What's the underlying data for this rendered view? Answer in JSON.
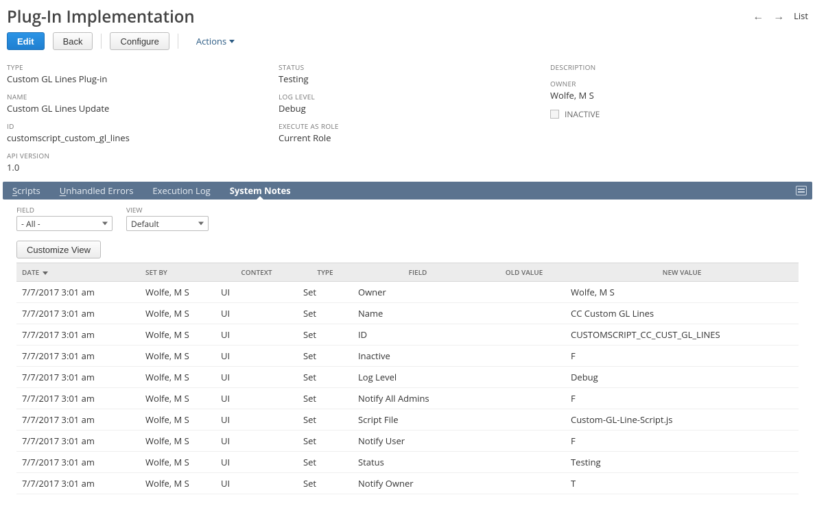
{
  "header": {
    "title": "Plug-In Implementation",
    "list_label": "List"
  },
  "toolbar": {
    "edit": "Edit",
    "back": "Back",
    "configure": "Configure",
    "actions": "Actions"
  },
  "details": {
    "col1": [
      {
        "label": "TYPE",
        "value": "Custom GL Lines Plug-in"
      },
      {
        "label": "NAME",
        "value": "Custom GL Lines Update"
      },
      {
        "label": "ID",
        "value": "customscript_custom_gl_lines"
      },
      {
        "label": "API VERSION",
        "value": "1.0"
      }
    ],
    "col2": [
      {
        "label": "STATUS",
        "value": "Testing"
      },
      {
        "label": "LOG LEVEL",
        "value": "Debug"
      },
      {
        "label": "EXECUTE AS ROLE",
        "value": "Current Role"
      }
    ],
    "col3": {
      "description_label": "DESCRIPTION",
      "owner_label": "OWNER",
      "owner_value": "Wolfe, M S",
      "inactive_label": "INACTIVE"
    }
  },
  "tabs": {
    "scripts": "Scripts",
    "unhandled": "Unhandled Errors",
    "execlog": "Execution Log",
    "sysnotes": "System Notes"
  },
  "filters": {
    "field_label": "FIELD",
    "field_value": "- All -",
    "view_label": "VIEW",
    "view_value": "Default"
  },
  "customize_button": "Customize View",
  "table": {
    "columns": [
      "DATE",
      "SET BY",
      "CONTEXT",
      "TYPE",
      "FIELD",
      "OLD VALUE",
      "NEW VALUE"
    ],
    "rows": [
      {
        "date": "7/7/2017 3:01 am",
        "set_by": "Wolfe, M S",
        "context": "UI",
        "type": "Set",
        "field": "Owner",
        "old": "",
        "new": "Wolfe, M S"
      },
      {
        "date": "7/7/2017 3:01 am",
        "set_by": "Wolfe, M S",
        "context": "UI",
        "type": "Set",
        "field": "Name",
        "old": "",
        "new": "CC Custom GL Lines"
      },
      {
        "date": "7/7/2017 3:01 am",
        "set_by": "Wolfe, M S",
        "context": "UI",
        "type": "Set",
        "field": "ID",
        "old": "",
        "new": "CUSTOMSCRIPT_CC_CUST_GL_LINES"
      },
      {
        "date": "7/7/2017 3:01 am",
        "set_by": "Wolfe, M S",
        "context": "UI",
        "type": "Set",
        "field": "Inactive",
        "old": "",
        "new": "F"
      },
      {
        "date": "7/7/2017 3:01 am",
        "set_by": "Wolfe, M S",
        "context": "UI",
        "type": "Set",
        "field": "Log Level",
        "old": "",
        "new": "Debug"
      },
      {
        "date": "7/7/2017 3:01 am",
        "set_by": "Wolfe, M S",
        "context": "UI",
        "type": "Set",
        "field": "Notify All Admins",
        "old": "",
        "new": "F"
      },
      {
        "date": "7/7/2017 3:01 am",
        "set_by": "Wolfe, M S",
        "context": "UI",
        "type": "Set",
        "field": "Script File",
        "old": "",
        "new": "Custom-GL-Line-Script.js"
      },
      {
        "date": "7/7/2017 3:01 am",
        "set_by": "Wolfe, M S",
        "context": "UI",
        "type": "Set",
        "field": "Notify User",
        "old": "",
        "new": "F"
      },
      {
        "date": "7/7/2017 3:01 am",
        "set_by": "Wolfe, M S",
        "context": "UI",
        "type": "Set",
        "field": "Status",
        "old": "",
        "new": "Testing"
      },
      {
        "date": "7/7/2017 3:01 am",
        "set_by": "Wolfe, M S",
        "context": "UI",
        "type": "Set",
        "field": "Notify Owner",
        "old": "",
        "new": "T"
      }
    ]
  }
}
